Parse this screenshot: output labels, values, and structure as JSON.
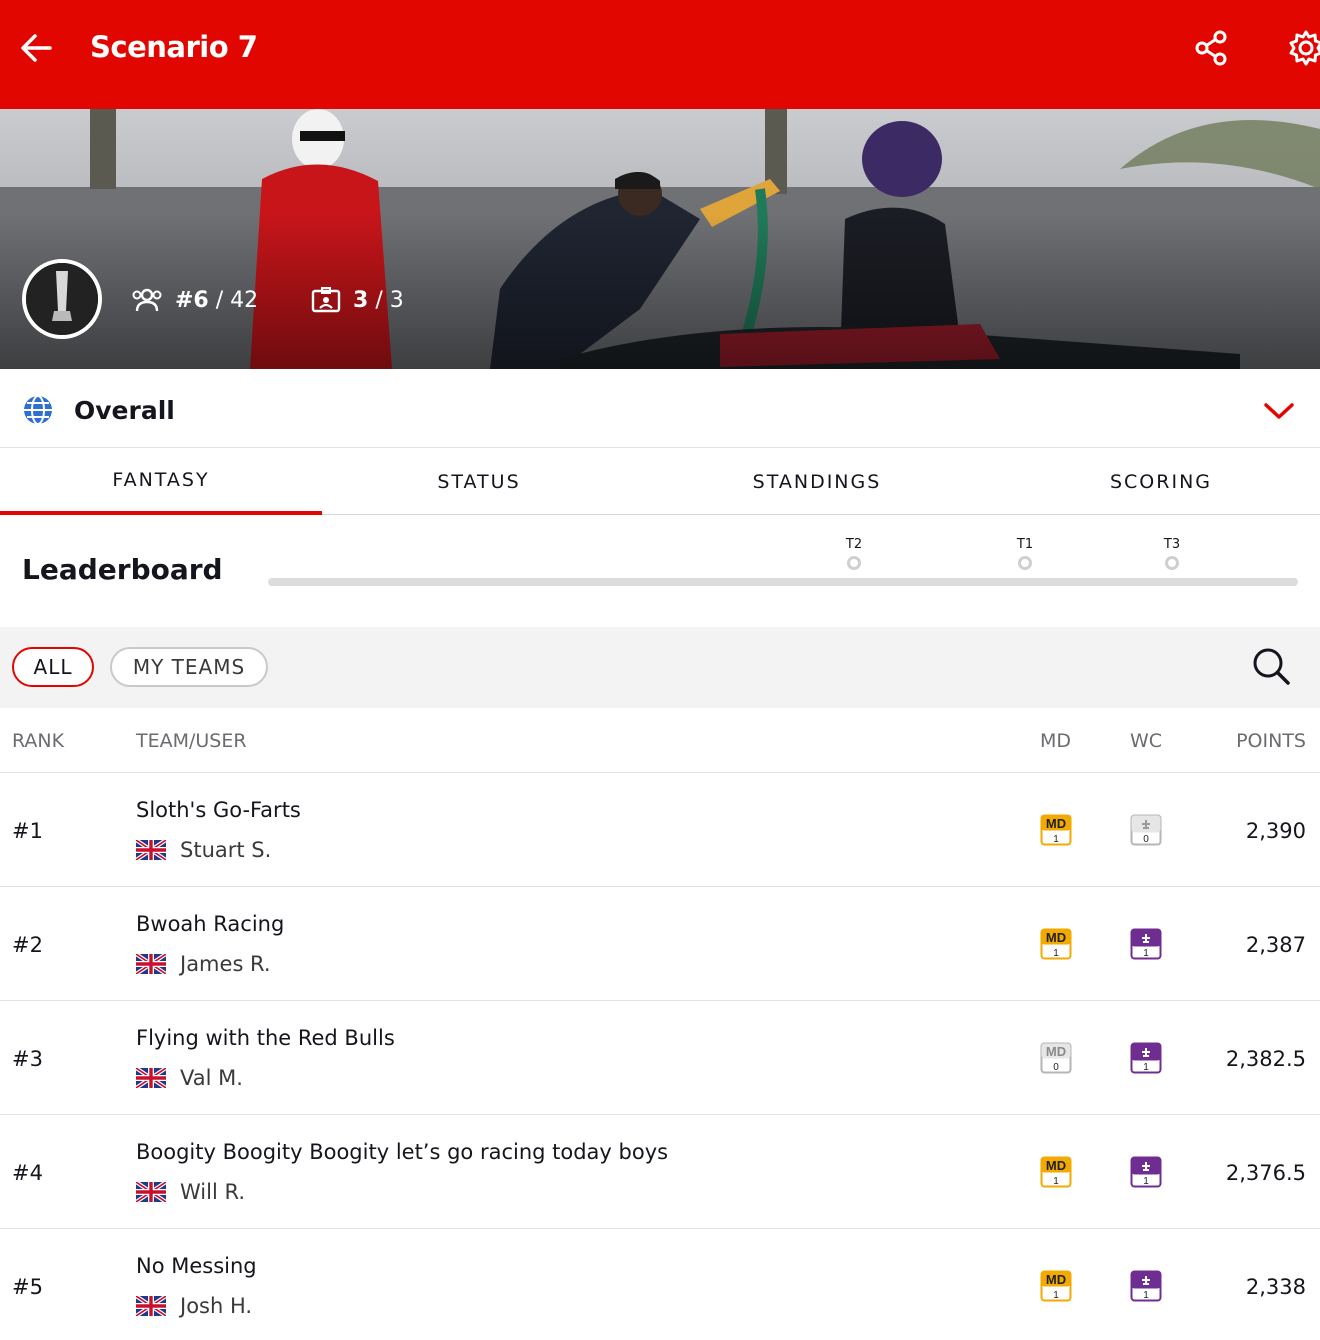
{
  "header": {
    "title": "Scenario 7",
    "color": "#e10600"
  },
  "hero": {
    "rank_current": "#6",
    "rank_sep": "/",
    "rank_total": "42",
    "teams_current": "3",
    "teams_sep": "/",
    "teams_total": "3"
  },
  "league": {
    "name": "Overall"
  },
  "tabs": [
    {
      "label": "FANTASY",
      "active": true
    },
    {
      "label": "STATUS",
      "active": false
    },
    {
      "label": "STANDINGS",
      "active": false
    },
    {
      "label": "SCORING",
      "active": false
    }
  ],
  "leaderboard": {
    "title": "Leaderboard",
    "markers": [
      "T2",
      "T1",
      "T3"
    ]
  },
  "filters": {
    "all": "ALL",
    "my_teams": "MY TEAMS"
  },
  "table": {
    "headers": {
      "rank": "RANK",
      "team": "TEAM/USER",
      "md": "MD",
      "wc": "WC",
      "points": "POINTS"
    },
    "rows": [
      {
        "rank": "#1",
        "team": "Sloth's Go-Farts",
        "user": "Stuart S.",
        "md_label": "MD",
        "md_count": "1",
        "md_active": true,
        "wc_count": "0",
        "wc_active": false,
        "points": "2,390"
      },
      {
        "rank": "#2",
        "team": "Bwoah Racing",
        "user": "James R.",
        "md_label": "MD",
        "md_count": "1",
        "md_active": true,
        "wc_count": "1",
        "wc_active": true,
        "points": "2,387"
      },
      {
        "rank": "#3",
        "team": "Flying with the Red Bulls",
        "user": "Val M.",
        "md_label": "MD",
        "md_count": "0",
        "md_active": false,
        "wc_count": "1",
        "wc_active": true,
        "points": "2,382.5"
      },
      {
        "rank": "#4",
        "team": "Boogity Boogity Boogity let’s go racing today boys",
        "user": "Will R.",
        "md_label": "MD",
        "md_count": "1",
        "md_active": true,
        "wc_count": "1",
        "wc_active": true,
        "points": "2,376.5"
      },
      {
        "rank": "#5",
        "team": "No Messing",
        "user": "Josh H.",
        "md_label": "MD",
        "md_count": "1",
        "md_active": true,
        "wc_count": "1",
        "wc_active": true,
        "points": "2,338"
      }
    ]
  },
  "colors": {
    "accent": "#e10600",
    "md_active": "#f2a900",
    "wc_active": "#6f2c91",
    "inactive": "#b5b5b5"
  }
}
